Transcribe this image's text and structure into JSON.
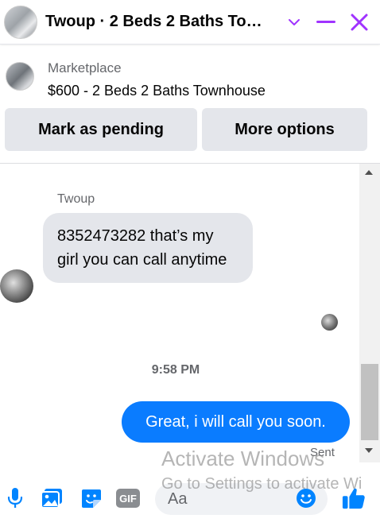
{
  "header": {
    "title": "Twoup · 2 Beds 2 Baths To…"
  },
  "marketplace": {
    "label": "Marketplace",
    "listing": "$600 - 2 Beds 2 Baths Townhouse"
  },
  "actions": {
    "pending_label": "Mark as pending",
    "more_label": "More options"
  },
  "thread": {
    "sender_name": "Twoup",
    "incoming_message": "8352473282 that’s my girl you can call anytime",
    "timestamp": "9:58 PM",
    "outgoing_message": "Great, i will call you soon.",
    "status": "Sent"
  },
  "watermark": {
    "line1": "Activate Windows",
    "line2": "Go to Settings to activate Wi"
  },
  "composer": {
    "placeholder": "Aa"
  },
  "colors": {
    "accent": "#a033ff",
    "outgoing_bubble": "#0a7cff",
    "incoming_bubble": "#e4e6eb",
    "icon_blue": "#0084ff"
  },
  "icons": [
    "chevron-down-icon",
    "minimize-icon",
    "close-icon",
    "microphone-icon",
    "photo-icon",
    "sticker-icon",
    "gif-icon",
    "emoji-icon",
    "thumbs-up-icon"
  ]
}
